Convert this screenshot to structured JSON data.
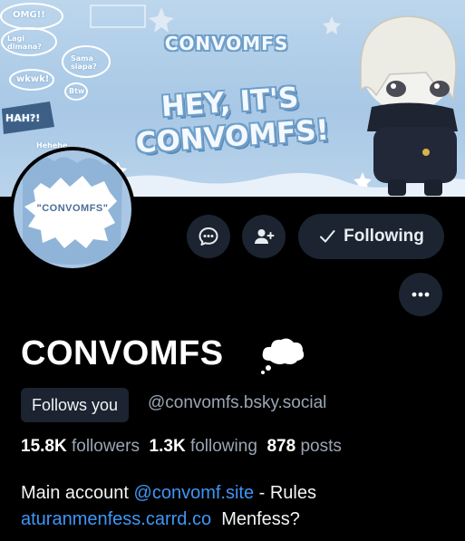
{
  "banner": {
    "logo_text": "CONVOMFS",
    "headline_line1": "HEY, IT'S",
    "headline_line2": "CONVOMFS!",
    "doodles": [
      "OMG!!",
      "Lagi dimana?",
      "Sama siapa?",
      "wkwk!",
      "HAH?!",
      "Btw",
      "Hehehe"
    ],
    "accent_color": "#a8c8e6"
  },
  "avatar": {
    "text": "\"CONVOMFS\""
  },
  "actions": {
    "message_icon": "chat-bubble-icon",
    "add_user_icon": "add-user-icon",
    "follow_label": "Following",
    "follow_icon": "checkmark-icon",
    "more_icon": "ellipsis-icon"
  },
  "profile": {
    "display_name": "CONVOMFS",
    "name_emoji": "thought-balloon-icon",
    "follows_you_label": "Follows you",
    "handle": "@convomfs.bsky.social"
  },
  "stats": {
    "followers_count": "15.8K",
    "followers_label": "followers",
    "following_count": "1.3K",
    "following_label": "following",
    "posts_count": "878",
    "posts_label": "posts"
  },
  "bio": {
    "text1": "Main account ",
    "link1": "@convomf.site",
    "text2": " - Rules",
    "link2": "aturanmenfess.carrd.co",
    "text3": "  Menfess?"
  },
  "colors": {
    "link": "#3f96f6",
    "button_bg": "#1b2430",
    "muted": "#9aa6b3"
  }
}
